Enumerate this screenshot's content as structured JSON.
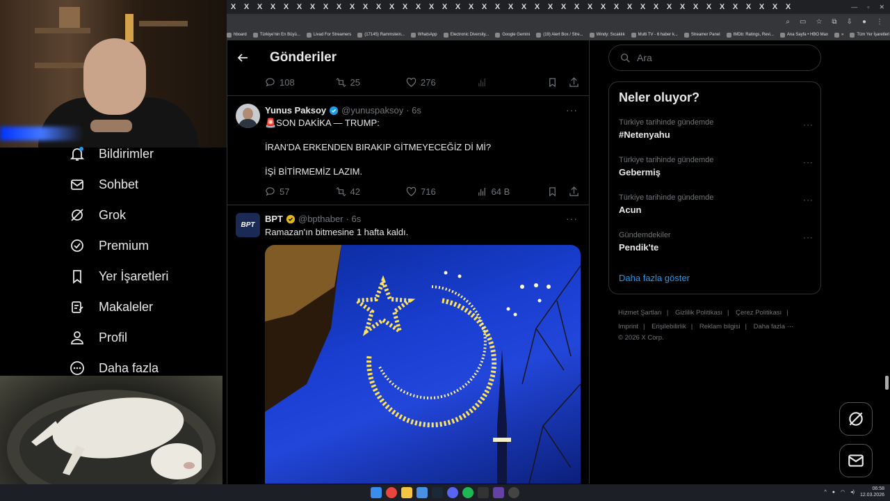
{
  "browser": {
    "tab_glyph": "X",
    "tab_count": 43,
    "bookmarks": [
      {
        "label": "hboard"
      },
      {
        "label": "Türkiye'nin En Büyü..."
      },
      {
        "label": "Livad For Streamers"
      },
      {
        "label": "(17145) Rammstein..."
      },
      {
        "label": "WhatsApp"
      },
      {
        "label": "Electronic Diversity..."
      },
      {
        "label": "Google Gemini"
      },
      {
        "label": "(19) Alert Box / Stre..."
      },
      {
        "label": "Windy: Sıcaklık"
      },
      {
        "label": "Multi TV - 6 haber k..."
      },
      {
        "label": "Streamer Panel"
      },
      {
        "label": "IMDb: Ratings, Revi..."
      },
      {
        "label": "Ana Sayfa • HBO Max"
      },
      {
        "label": "»"
      },
      {
        "label": "Tüm Yer İşaretleri"
      }
    ]
  },
  "nav": {
    "items": [
      {
        "label": "Bildirimler",
        "icon": "bell-icon"
      },
      {
        "label": "Sohbet",
        "icon": "mail-icon"
      },
      {
        "label": "Grok",
        "icon": "grok-icon"
      },
      {
        "label": "Premium",
        "icon": "verified-icon"
      },
      {
        "label": "Yer İşaretleri",
        "icon": "bookmark-icon"
      },
      {
        "label": "Makaleler",
        "icon": "article-icon"
      },
      {
        "label": "Profil",
        "icon": "person-icon"
      },
      {
        "label": "Daha fazla",
        "icon": "more-circle-icon"
      }
    ]
  },
  "main": {
    "title": "Gönderiler",
    "prev_post_stats": {
      "replies": "108",
      "reposts": "25",
      "likes": "276"
    },
    "posts": [
      {
        "name": "Yunus Paksoy",
        "handle": "@yunuspaksoy",
        "time": "· 6s",
        "lines": [
          "🚨SON DAKİKA — TRUMP:",
          "İRAN'DA ERKENDEN BIRAKIP GİTMEYECEĞİZ Dİ Mİ?",
          "İŞİ BİTİRMEMİZ LAZIM."
        ],
        "stats": {
          "replies": "57",
          "reposts": "42",
          "likes": "716",
          "views": "64 B"
        }
      },
      {
        "name": "BPT",
        "handle": "@bpthaber",
        "time": "· 6s",
        "avatar_text": "BPT",
        "lines": [
          "Ramazan'ın bitmesine 1 hafta kaldı."
        ]
      }
    ]
  },
  "sidebar": {
    "search_placeholder": "Ara",
    "trends_title": "Neler oluyor?",
    "trends": [
      {
        "category": "Türkiye tarihinde gündemde",
        "name": "#Netenyahu"
      },
      {
        "category": "Türkiye tarihinde gündemde",
        "name": "Gebermiş"
      },
      {
        "category": "Türkiye tarihinde gündemde",
        "name": "Acun"
      },
      {
        "category": "Gündemdekiler",
        "name": "Pendik'te"
      }
    ],
    "show_more": "Daha fazla göster",
    "footer_links": [
      "Hizmet Şartları",
      "Gizlilik Politikası",
      "Çerez Politikası",
      "Imprint",
      "Erişilebilirlik",
      "Reklam bilgisi",
      "Daha fazla ···"
    ],
    "copyright": "© 2026 X Corp."
  },
  "taskbar": {
    "time": "06:58",
    "date": "12.03.2026"
  },
  "colors": {
    "accent": "#1d9bf0",
    "verified_gold": "#e2b719",
    "background": "#000000",
    "border": "#2f3336"
  }
}
